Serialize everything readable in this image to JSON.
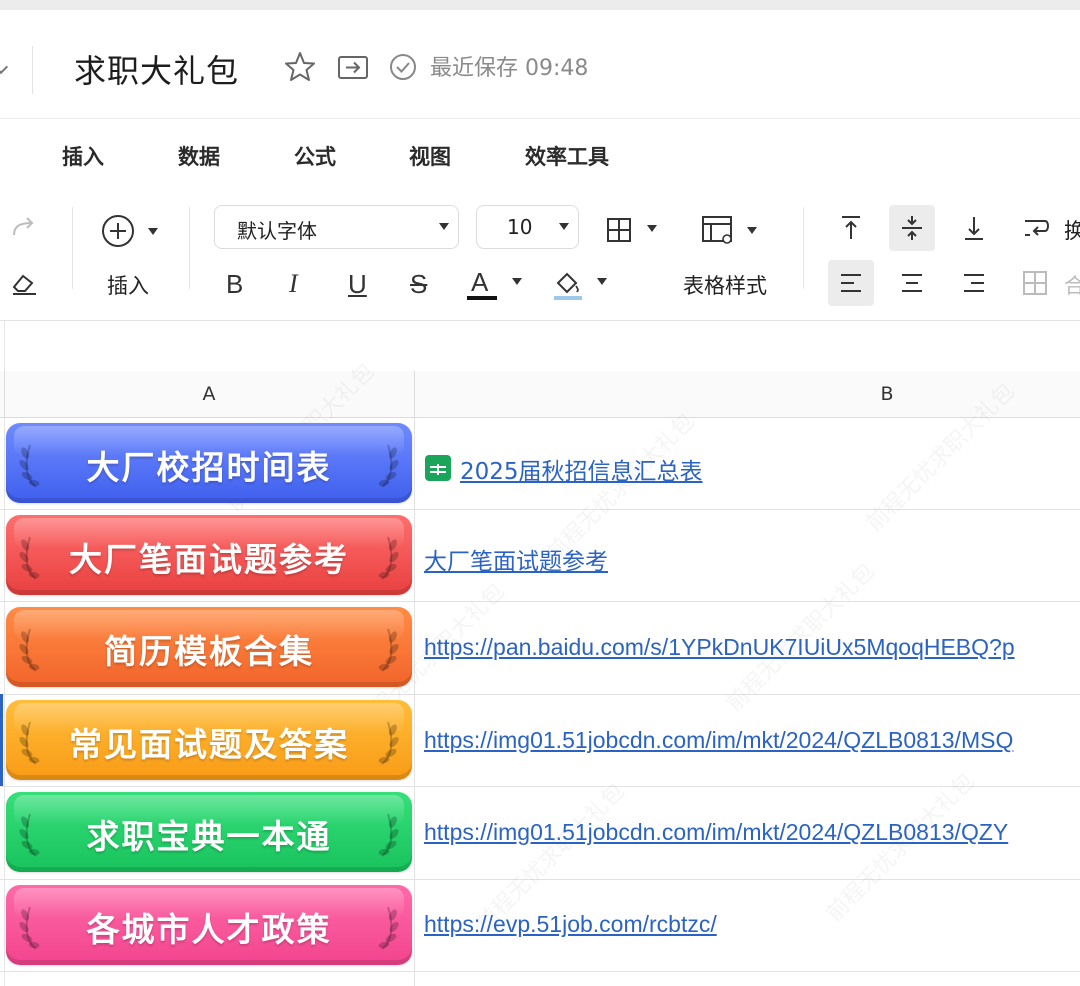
{
  "title_bar": {
    "doc_title": "求职大礼包",
    "save_status": "最近保存 09:48"
  },
  "menu": {
    "items": [
      "插入",
      "数据",
      "公式",
      "视图",
      "效率工具"
    ]
  },
  "toolbar": {
    "insert_label": "插入",
    "font_name": "默认字体",
    "font_size": "10",
    "table_style_label": "表格样式",
    "bold": "B",
    "italic": "I",
    "underline": "U",
    "strike": "S",
    "font_color": "A",
    "wrap_label_partial": "换",
    "merge_label_partial": "合"
  },
  "sheet": {
    "columns": [
      "A",
      "B"
    ],
    "rows": [
      {
        "label": "大厂校招时间表",
        "link": "2025届秋招信息汇总表",
        "color_top": "#6f8bff",
        "color_bottom": "#3f5fee",
        "has_sheet_icon": true
      },
      {
        "label": "大厂笔面试题参考",
        "link": "大厂笔面试题参考",
        "color_top": "#ff6e6e",
        "color_bottom": "#e8403f",
        "has_sheet_icon": false
      },
      {
        "label": "简历模板合集",
        "link": "https://pan.baidu.com/s/1YPkDnUK7IUiUx5MqoqHEBQ?p",
        "color_top": "#ff8c45",
        "color_bottom": "#f2642a",
        "has_sheet_icon": false
      },
      {
        "label": "常见面试题及答案",
        "link": "https://img01.51jobcdn.com/im/mkt/2024/QZLB0813/MSQ",
        "color_top": "#ffbd3a",
        "color_bottom": "#f99b16",
        "has_sheet_icon": false
      },
      {
        "label": "求职宝典一本通",
        "link": "https://img01.51jobcdn.com/im/mkt/2024/QZLB0813/QZY",
        "color_top": "#36df7a",
        "color_bottom": "#18c25c",
        "has_sheet_icon": false
      },
      {
        "label": "各城市人才政策",
        "link": "https://evp.51job.com/rcbtzc/",
        "color_top": "#ff6aa8",
        "color_bottom": "#f2448e",
        "has_sheet_icon": false
      }
    ]
  },
  "watermark": "前程无忧求职大礼包"
}
